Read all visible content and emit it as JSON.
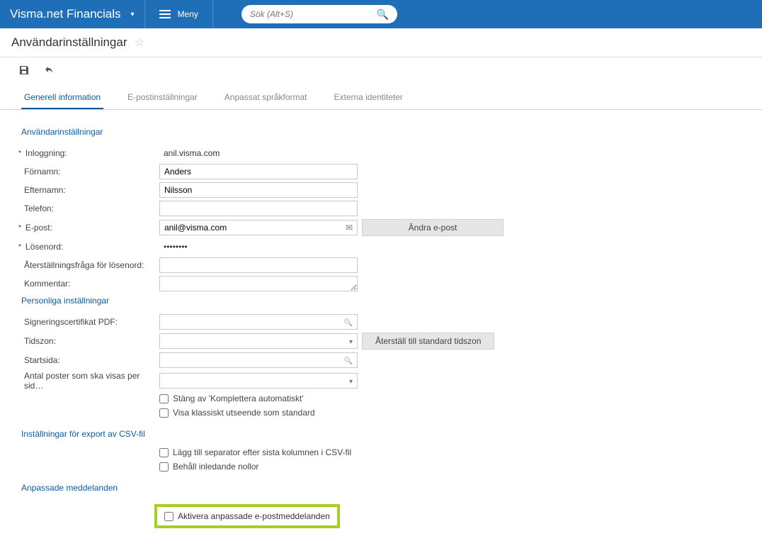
{
  "topbar": {
    "app_name": "Visma.net Financials",
    "menu_label": "Meny",
    "search_placeholder": "Sök (Alt+S)"
  },
  "subheader": {
    "title": "Användarinställningar"
  },
  "tabs": [
    {
      "label": "Generell information",
      "active": true
    },
    {
      "label": "E-postinställningar",
      "active": false
    },
    {
      "label": "Anpassat språkformat",
      "active": false
    },
    {
      "label": "Externa identiteter",
      "active": false
    }
  ],
  "sections": {
    "user": {
      "title": "Användarinställningar",
      "login_label": "Inloggning:",
      "login_value": "anil.visma.com",
      "firstname_label": "Förnamn:",
      "firstname_value": "Anders",
      "lastname_label": "Efternamn:",
      "lastname_value": "Nilsson",
      "phone_label": "Telefon:",
      "phone_value": "",
      "email_label": "E-post:",
      "email_value": "anil@visma.com",
      "email_button": "Ändra e-post",
      "password_label": "Lösenord:",
      "password_value": "••••••••",
      "recovery_label": "Återställningsfråga för lösenord:",
      "recovery_value": "",
      "comment_label": "Kommentar:",
      "comment_value": ""
    },
    "personal": {
      "title": "Personliga inställningar",
      "cert_label": "Signeringscertifikat PDF:",
      "cert_value": "",
      "tz_label": "Tidszon:",
      "tz_value": "",
      "tz_reset_button": "Återställ till standard tidszon",
      "startpage_label": "Startsida:",
      "startpage_value": "",
      "rows_label": "Antal poster som ska visas per sid…",
      "rows_value": "",
      "cb_autocomplete": "Stäng av 'Komplettera automatiskt'",
      "cb_classic": "Visa klassiskt utseende som standard"
    },
    "csv": {
      "title": "Inställningar för export av CSV-fil",
      "cb_separator": "Lägg till separator efter sista kolumnen i CSV-fil",
      "cb_zeros": "Behåll inledande nollor"
    },
    "custom_msg": {
      "title": "Anpassade meddelanden",
      "cb_enable": "Aktivera anpassade e-postmeddelanden"
    }
  }
}
